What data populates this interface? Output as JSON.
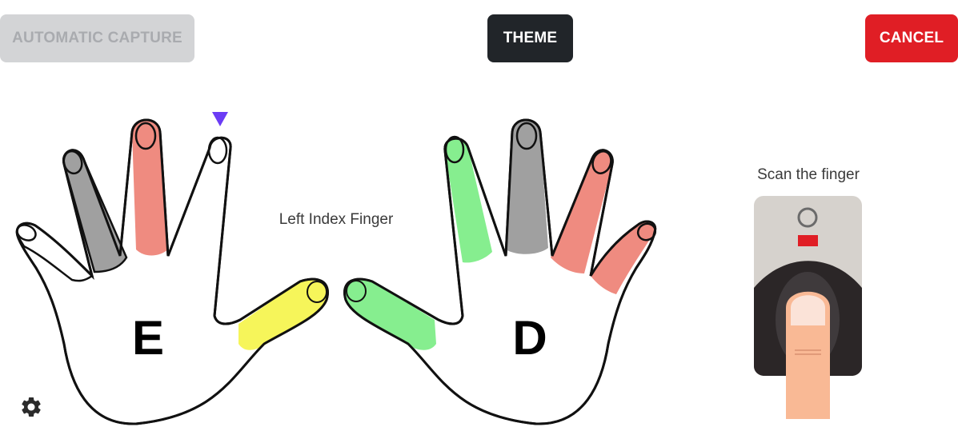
{
  "toolbar": {
    "automatic_capture_label": "AUTOMATIC CAPTURE",
    "theme_label": "THEME",
    "cancel_label": "CANCEL"
  },
  "hands": {
    "left_hand_letter": "E",
    "right_hand_letter": "D",
    "selected_finger_label": "Left Index Finger",
    "selected_finger": "left-index",
    "finger_states": {
      "left_pinky": "none",
      "left_ring": "captured-gray",
      "left_middle": "failed-red",
      "left_index": "selected",
      "left_thumb": "warning-yellow",
      "right_thumb": "ok-green",
      "right_index": "ok-green",
      "right_middle": "captured-gray",
      "right_ring": "failed-red",
      "right_pinky": "failed-red"
    }
  },
  "scanner": {
    "instruction": "Scan the finger"
  },
  "colors": {
    "gray": "#a0a0a0",
    "red": "#ef8b80",
    "yellow": "#f6f55a",
    "green": "#86ee8f",
    "marker": "#6b3cf5",
    "cancel": "#e01e25",
    "theme": "#212529"
  },
  "icons": {
    "settings": "gear-icon",
    "selection_marker": "triangle-down-icon"
  }
}
